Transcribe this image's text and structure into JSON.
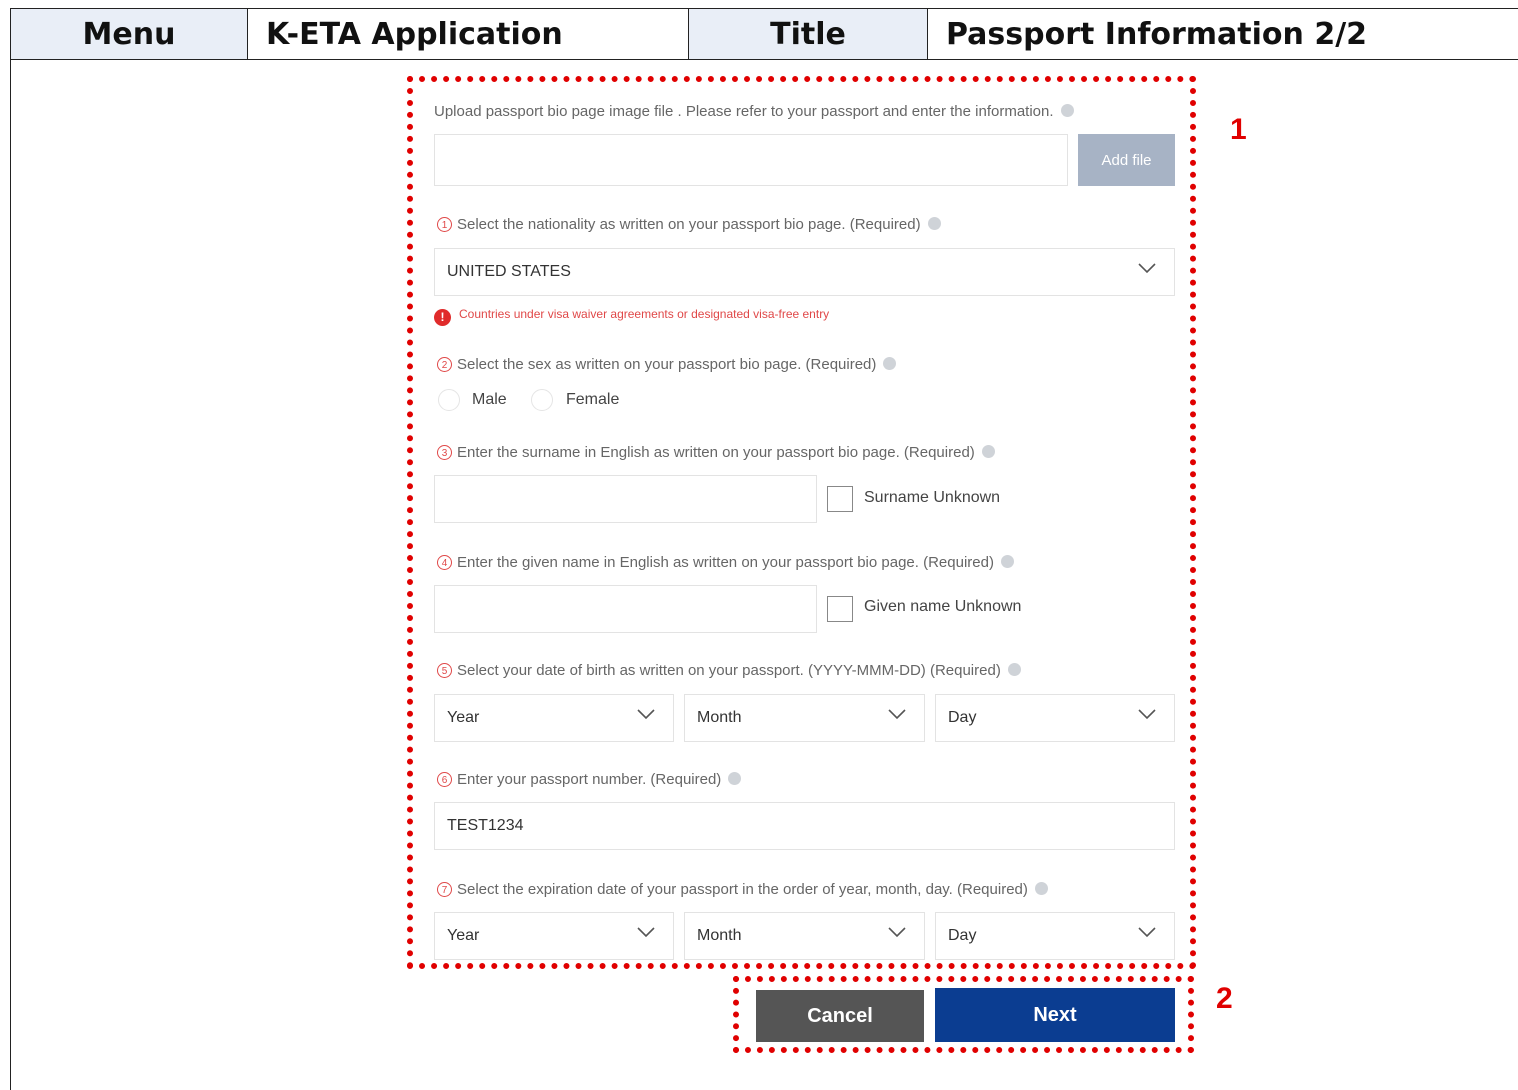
{
  "header": {
    "menu_key": "Menu",
    "menu_value": "K-ETA Application",
    "title_key": "Title",
    "title_value": "Passport Information 2/2"
  },
  "callouts": {
    "one": "1",
    "two": "2"
  },
  "upload": {
    "label": "Upload passport bio page image file . Please refer to your passport and enter the information.",
    "file_value": "",
    "add_button": "Add file"
  },
  "nationality": {
    "step": "1",
    "label": "Select the nationality as written on your passport bio page. (Required)",
    "value": "UNITED STATES",
    "warning": "Countries under visa waiver agreements or designated visa-free entry"
  },
  "sex": {
    "step": "2",
    "label": "Select the sex as written on your passport bio page. (Required)",
    "options": [
      "Male",
      "Female"
    ]
  },
  "surname": {
    "step": "3",
    "label": "Enter the surname in English as written on your passport bio page. (Required)",
    "value": "",
    "unknown_label": "Surname Unknown"
  },
  "given_name": {
    "step": "4",
    "label": "Enter the given name in English as written on your passport bio page. (Required)",
    "value": "",
    "unknown_label": "Given name Unknown"
  },
  "dob": {
    "step": "5",
    "label": "Select your date of birth as written on your passport. (YYYY-MMM-DD) (Required)",
    "year": "Year",
    "month": "Month",
    "day": "Day"
  },
  "passport_number": {
    "step": "6",
    "label": "Enter your passport number. (Required)",
    "value": "TEST1234"
  },
  "expiration": {
    "step": "7",
    "label": "Select the expiration date of your passport in the order of year, month, day. (Required)",
    "year": "Year",
    "month": "Month",
    "day": "Day"
  },
  "actions": {
    "cancel": "Cancel",
    "next": "Next"
  },
  "colors": {
    "callout": "#e00000",
    "next": "#0b3d91",
    "cancel": "#555555",
    "add_file": "#a7b3c5",
    "required": "#e04848"
  }
}
